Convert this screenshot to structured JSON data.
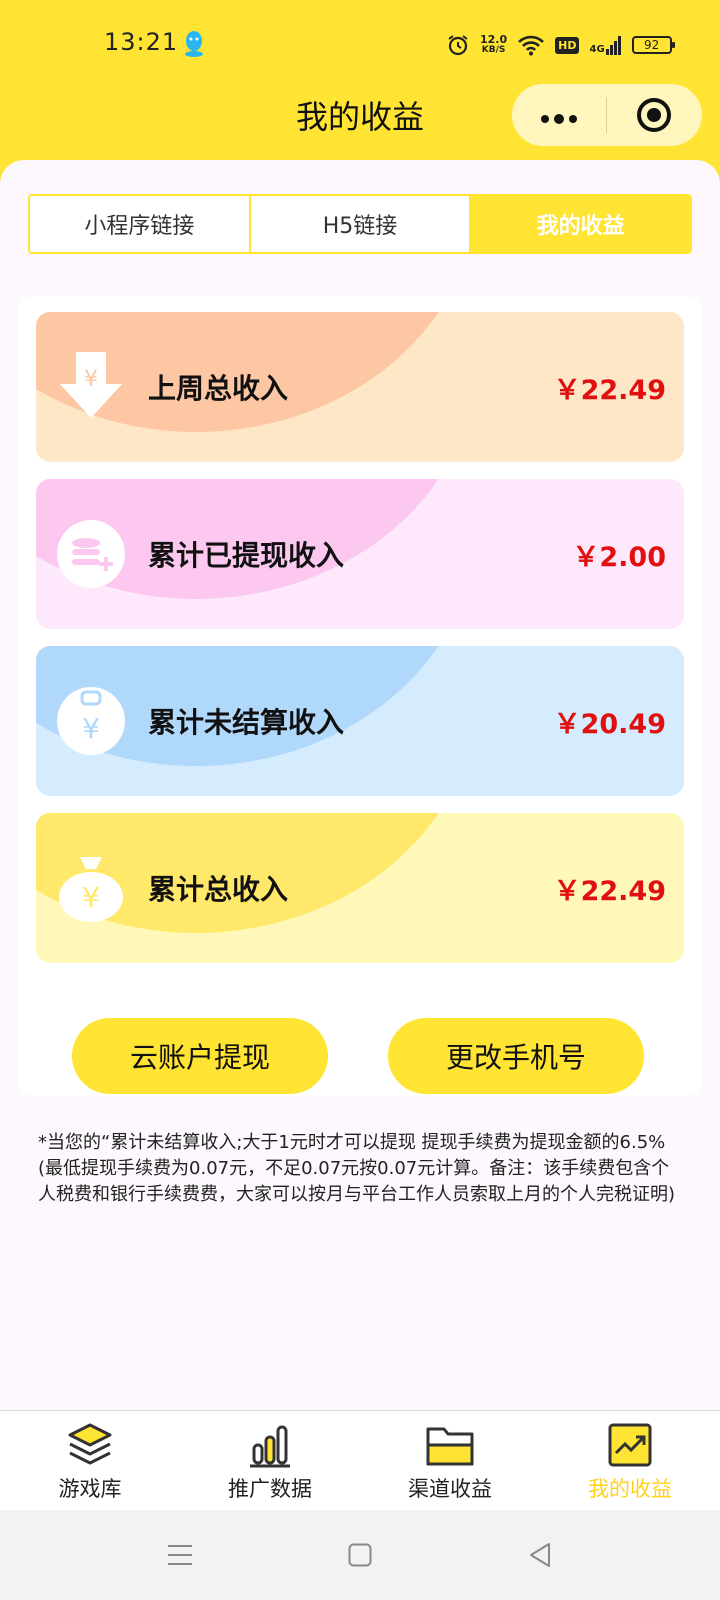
{
  "status_bar": {
    "time": "13:21",
    "net_speed": "12.0",
    "net_speed_unit": "KB/S",
    "hd": "HD",
    "network": "4G",
    "battery": "92"
  },
  "nav": {
    "title": "我的收益",
    "more_icon": "more-dots-icon",
    "close_icon": "target-circle-icon"
  },
  "tabs": [
    {
      "label": "小程序链接",
      "active": false
    },
    {
      "label": "H5链接",
      "active": false
    },
    {
      "label": "我的收益",
      "active": true
    }
  ],
  "income_cards": [
    {
      "label": "上周总收入",
      "amount": "￥22.49",
      "icon": "yen-download-icon",
      "bg": "#fde7c7",
      "blob": "#fcc7a2"
    },
    {
      "label": "累计已提现收入",
      "amount": "￥2.00",
      "icon": "coins-plus-icon",
      "bg": "#fde9fb",
      "blob": "#fcc8f0"
    },
    {
      "label": "累计未结算收入",
      "amount": "￥20.49",
      "icon": "yen-clipboard-icon",
      "bg": "#d4ecfd",
      "blob": "#b0d8fb"
    },
    {
      "label": "累计总收入",
      "amount": "￥22.49",
      "icon": "money-bag-icon",
      "bg": "#fff8b8",
      "blob": "#ffe86a"
    }
  ],
  "buttons": {
    "withdraw": "云账户提现",
    "change_phone": "更改手机号"
  },
  "note": "*当您的“累计未结算收入;大于1元时才可以提现 提现手续费为提现金额的6.5%(最低提现手续费为0.07元，不足0.07元按0.07元计算。备注：该手续费包含个人税费和银行手续费费，大家可以按月与平台工作人员索取上月的个人完税证明)",
  "tabbar": [
    {
      "label": "游戏库",
      "icon": "layers-icon",
      "active": false
    },
    {
      "label": "推广数据",
      "icon": "bar-chart-icon",
      "active": false
    },
    {
      "label": "渠道收益",
      "icon": "folder-icon",
      "active": false
    },
    {
      "label": "我的收益",
      "icon": "trend-chart-icon",
      "active": true
    }
  ],
  "colors": {
    "accent": "#ffe433",
    "amount": "#e01010"
  }
}
